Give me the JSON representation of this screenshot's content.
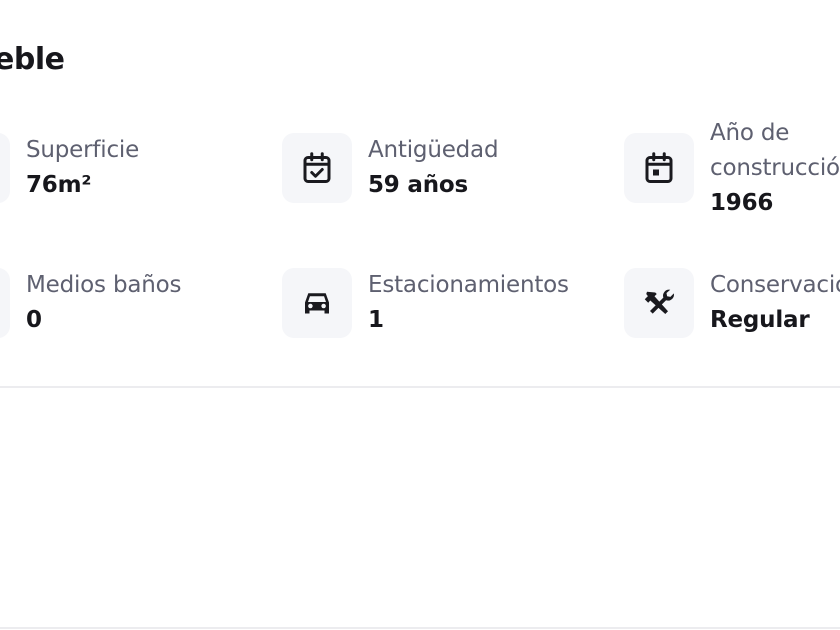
{
  "section": {
    "title": "eble"
  },
  "features": [
    {
      "label": "Superficie",
      "value": "76m²",
      "icon": "area-icon"
    },
    {
      "label": "Antigüedad",
      "value": "59 años",
      "icon": "calendar-check-icon"
    },
    {
      "label": "Año de construcción",
      "value": "1966",
      "icon": "calendar-event-icon"
    },
    {
      "label": "Medios baños",
      "value": "0",
      "icon": "half-bath-icon"
    },
    {
      "label": "Estacionamientos",
      "value": "1",
      "icon": "car-icon"
    },
    {
      "label": "Conservación",
      "value": "Regular",
      "icon": "tools-icon"
    }
  ],
  "colors": {
    "icon_background": "#f5f6f9",
    "label_text": "#5e6070",
    "value_text": "#17171c",
    "divider": "#ececef"
  }
}
